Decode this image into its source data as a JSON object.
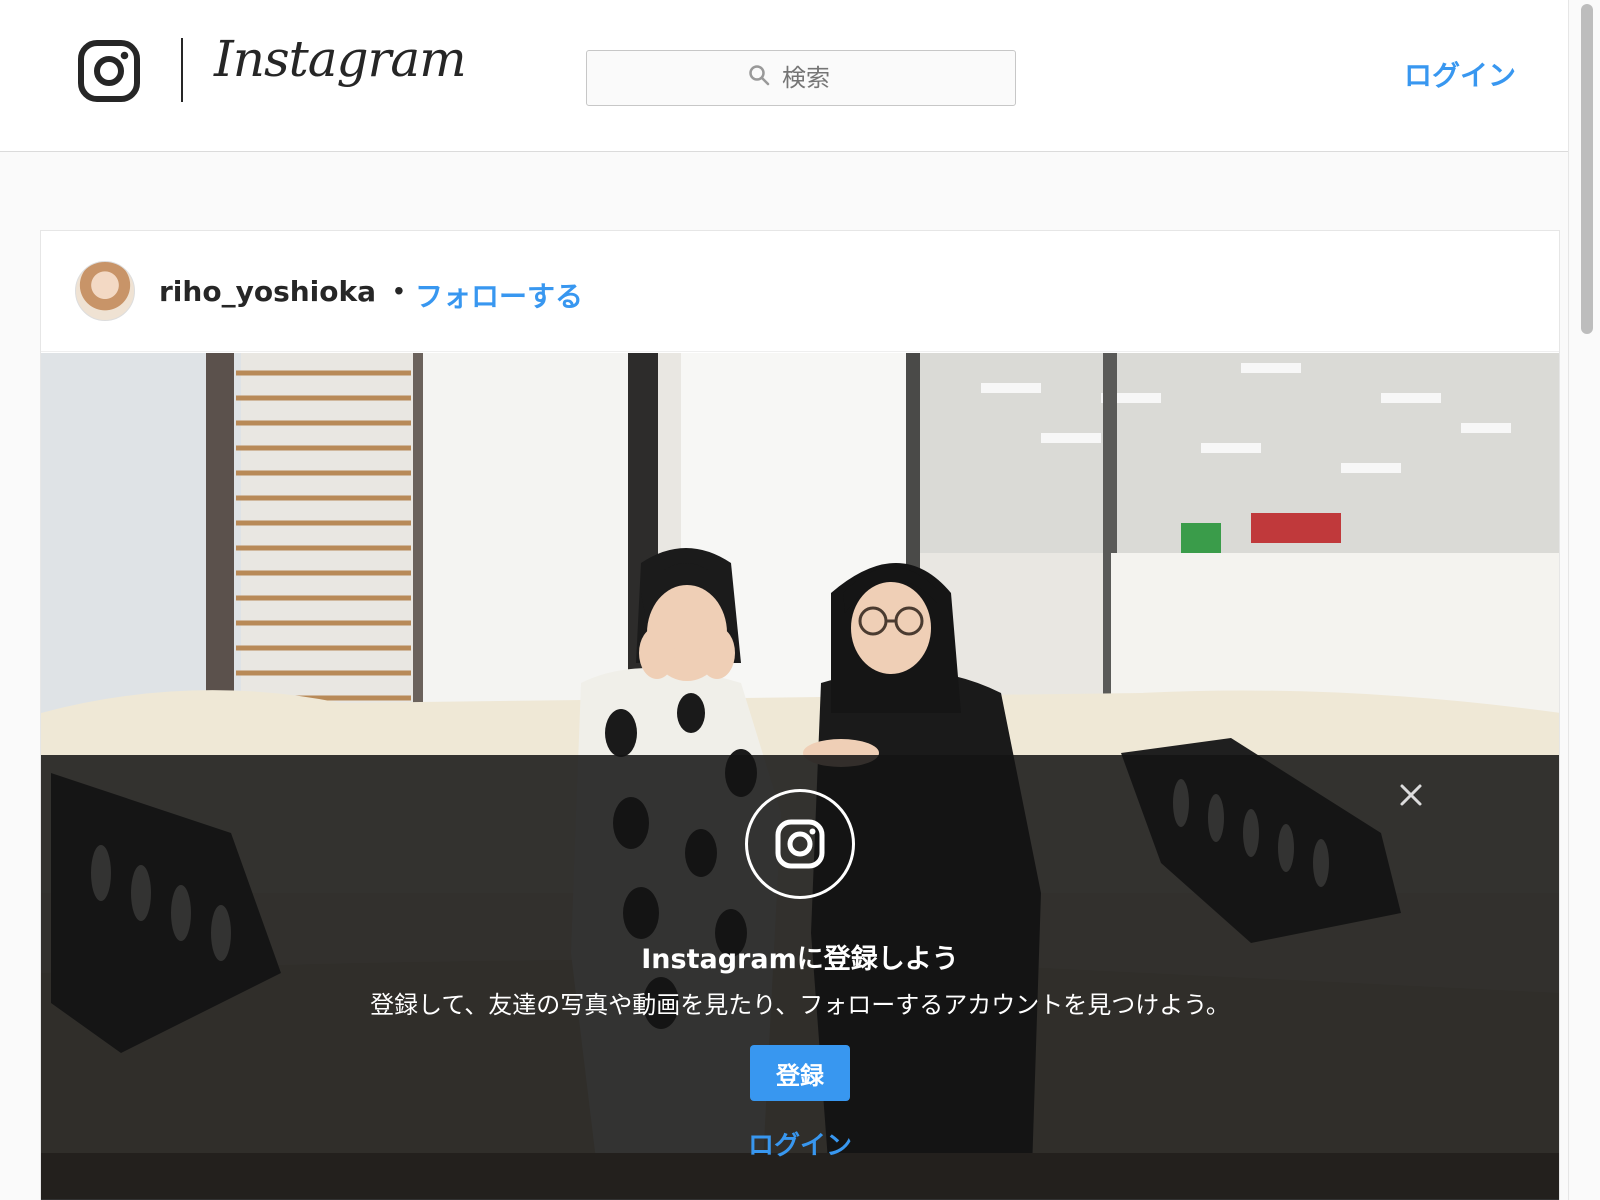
{
  "header": {
    "brand": "Instagram",
    "search_placeholder": "検索",
    "login_label": "ログイン",
    "icons": [
      "instagram-camera-icon",
      "search-icon"
    ]
  },
  "post": {
    "username": "riho_yoshioka",
    "separator": "•",
    "follow_label": "フォローする"
  },
  "signup_banner": {
    "title": "Instagramに登録しよう",
    "description": "登録して、友達の写真や動画を見たり、フォローするアカウントを見つけよう。",
    "signup_label": "登録",
    "login_label": "ログイン",
    "icons": [
      "close-icon",
      "instagram-camera-icon"
    ]
  },
  "colors": {
    "accent": "#3897f0",
    "text": "#262626",
    "background": "#fafafa",
    "overlay": "#141414"
  }
}
